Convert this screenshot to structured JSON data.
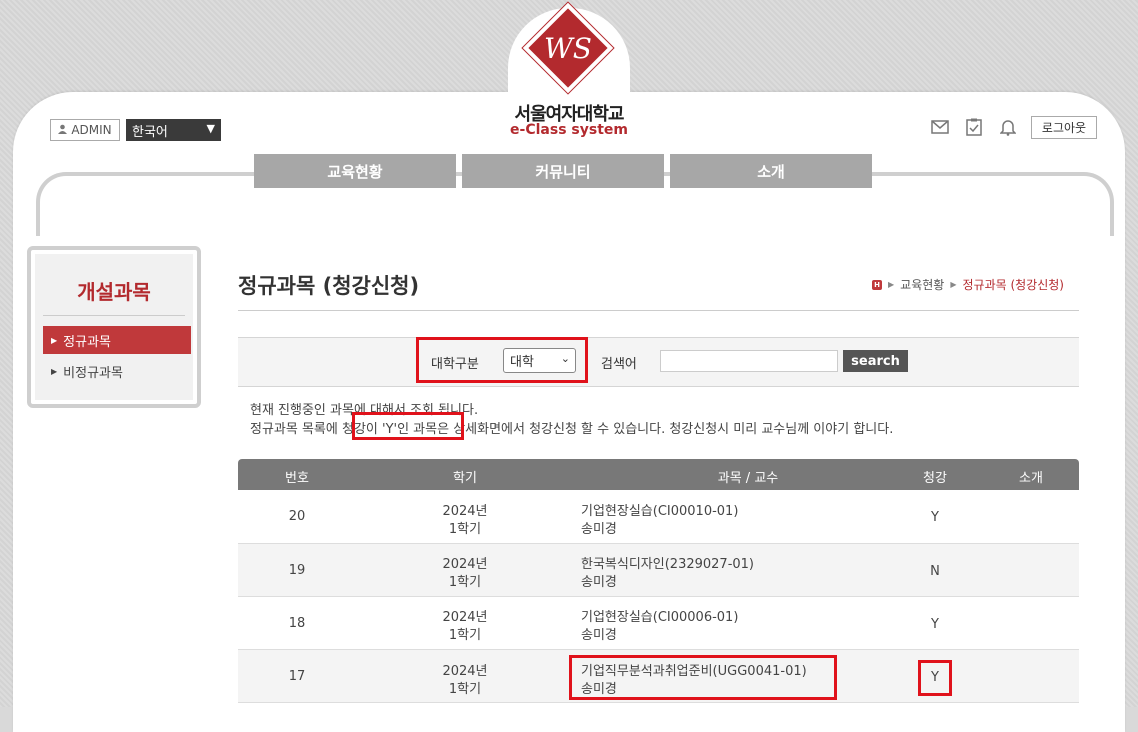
{
  "header": {
    "logo_letters": "WS",
    "university_name": "서울여자대학교",
    "system_name": "e-Class system",
    "admin_label": "ADMIN",
    "language": "한국어",
    "logout_label": "로그아웃",
    "icons": [
      "mail-icon",
      "checklist-icon",
      "bell-icon",
      "user-icon"
    ]
  },
  "nav": {
    "items": [
      {
        "label": "교육현황"
      },
      {
        "label": "커뮤니티"
      },
      {
        "label": "소개"
      }
    ]
  },
  "sidebar": {
    "title": "개설과목",
    "items": [
      {
        "label": "정규과목",
        "active": true
      },
      {
        "label": "비정규과목",
        "active": false
      }
    ]
  },
  "page": {
    "title": "정규과목 (청강신청)",
    "breadcrumb": {
      "home": "H",
      "level1": "교육현황",
      "current": "정규과목 (청강신청)"
    }
  },
  "search": {
    "category_label": "대학구분",
    "category_value": "대학",
    "keyword_label": "검색어",
    "keyword_value": "",
    "button_label": "search"
  },
  "info": {
    "line1": "현재 진행중인 과목에 대해서 조회 됩니다.",
    "line2": "정규과목 목록에 청강이 'Y'인 과목은 상세화면에서 청강신청 할 수 있습니다. 청강신청시 미리 교수님께 이야기 합니다."
  },
  "table": {
    "headers": {
      "no": "번호",
      "semester": "학기",
      "course": "과목 / 교수",
      "audit": "청강",
      "intro": "소개"
    },
    "rows": [
      {
        "no": "20",
        "year": "2024년",
        "term": "1학기",
        "course": "기업현장실습(CI00010-01)",
        "professor": "송미경",
        "audit": "Y"
      },
      {
        "no": "19",
        "year": "2024년",
        "term": "1학기",
        "course": "한국복식디자인(2329027-01)",
        "professor": "송미경",
        "audit": "N"
      },
      {
        "no": "18",
        "year": "2024년",
        "term": "1학기",
        "course": "기업현장실습(CI00006-01)",
        "professor": "송미경",
        "audit": "Y"
      },
      {
        "no": "17",
        "year": "2024년",
        "term": "1학기",
        "course": "기업직무분석과취업준비(UGG0041-01)",
        "professor": "송미경",
        "audit": "Y"
      }
    ]
  },
  "colors": {
    "accent": "#b32a2e",
    "highlight": "#e0121b",
    "nav_bg": "#a7a7a7",
    "table_header": "#787878"
  }
}
